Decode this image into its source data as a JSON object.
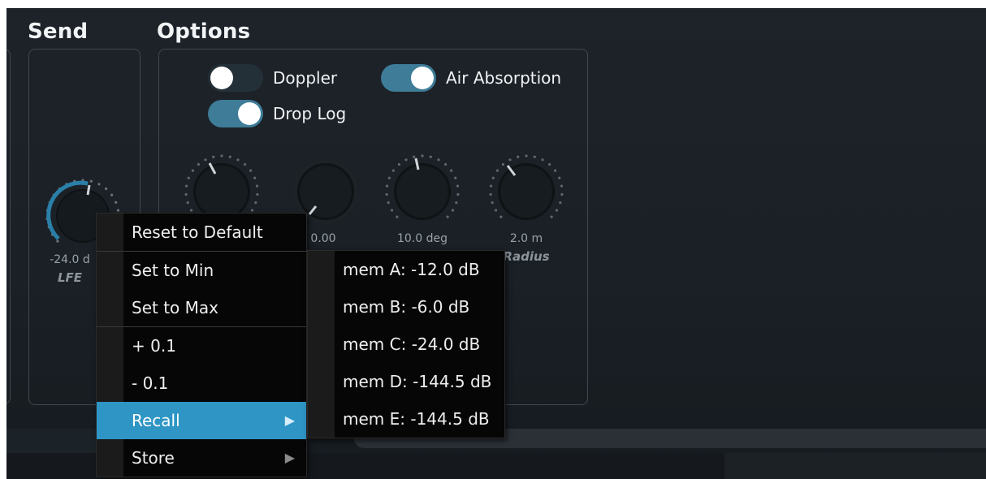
{
  "sections": {
    "send_title": "Send",
    "options_title": "Options"
  },
  "options": {
    "toggles": [
      {
        "label": "Doppler",
        "state": "off"
      },
      {
        "label": "Air Absorption",
        "state": "on"
      },
      {
        "label": "Drop Log",
        "state": "on"
      }
    ]
  },
  "knobs": {
    "lfe": {
      "value_text": "-24.0 d",
      "name": "LFE"
    },
    "k2": {
      "value_text": "0.00",
      "name": ""
    },
    "k3": {
      "value_text": "10.0 deg",
      "name": ""
    },
    "k4": {
      "value_text": "2.0 m",
      "name": "Radius"
    }
  },
  "context_menu": {
    "items": [
      {
        "label": "Reset to Default",
        "submenu": false,
        "highlighted": false
      },
      {
        "label": "Set to Min",
        "submenu": false,
        "highlighted": false
      },
      {
        "label": "Set to Max",
        "submenu": false,
        "highlighted": false
      },
      {
        "label": "+ 0.1",
        "submenu": false,
        "highlighted": false
      },
      {
        "label": "- 0.1",
        "submenu": false,
        "highlighted": false
      },
      {
        "label": "Recall",
        "submenu": true,
        "highlighted": true
      },
      {
        "label": "Store",
        "submenu": true,
        "highlighted": false
      }
    ],
    "submenu_arrow": "▶"
  },
  "recall_submenu": {
    "items": [
      {
        "label": "mem A: -12.0 dB"
      },
      {
        "label": "mem B: -6.0 dB"
      },
      {
        "label": "mem C: -24.0 dB"
      },
      {
        "label": "mem D: -144.5 dB"
      },
      {
        "label": "mem E: -144.5 dB"
      }
    ]
  },
  "colors": {
    "accent": "#2e95c5",
    "toggle_on": "#3e7c98",
    "background": "#1b2127"
  }
}
